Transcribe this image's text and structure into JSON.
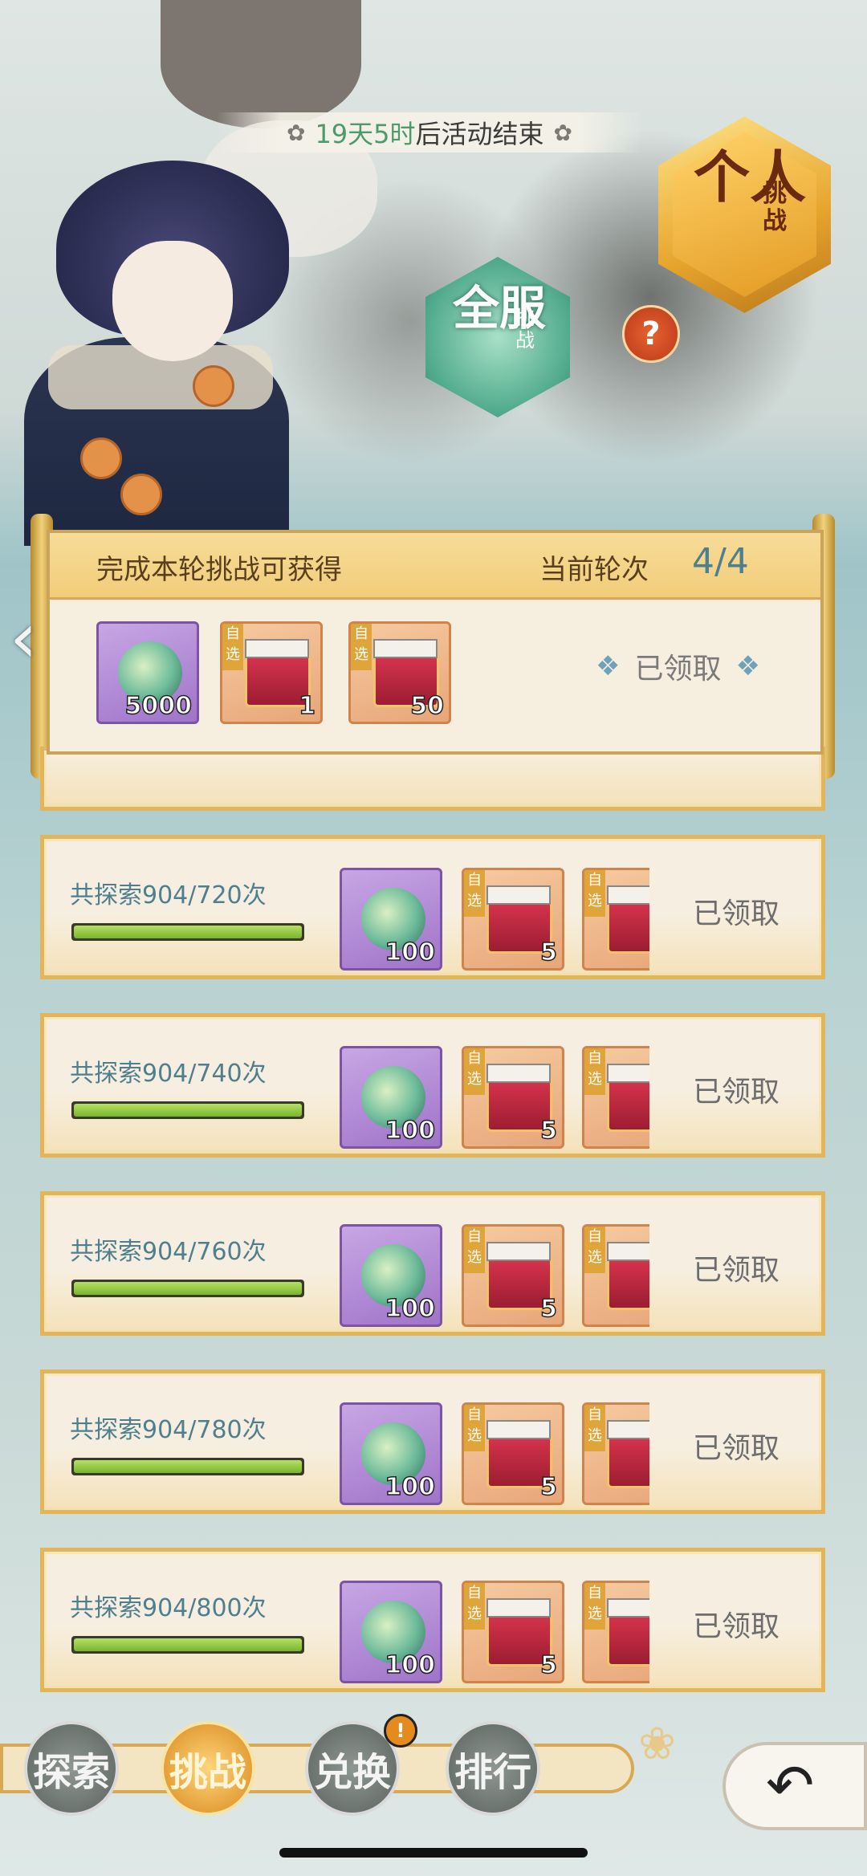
{
  "timer": {
    "highlight": "19天5时",
    "rest": "后活动结束"
  },
  "badges": {
    "personal": {
      "big": "个人",
      "small": "挑战"
    },
    "server": {
      "big": "全服",
      "small": "挑战"
    },
    "help": "?"
  },
  "round_panel": {
    "title": "完成本轮挑战可获得",
    "round_label": "当前轮次",
    "round_value": "4/4",
    "rewards": [
      {
        "type": "item",
        "count": "5000",
        "tag": ""
      },
      {
        "type": "box",
        "count": "1",
        "tag": "自选"
      },
      {
        "type": "box",
        "count": "50",
        "tag": "自选"
      }
    ],
    "status": "已领取"
  },
  "tasks": [
    {
      "label": "共探索904/720次",
      "progress": 1.0,
      "rewards": [
        "100",
        "5"
      ],
      "tag": "自选",
      "status": "已领取"
    },
    {
      "label": "共探索904/740次",
      "progress": 1.0,
      "rewards": [
        "100",
        "5"
      ],
      "tag": "自选",
      "status": "已领取"
    },
    {
      "label": "共探索904/760次",
      "progress": 1.0,
      "rewards": [
        "100",
        "5"
      ],
      "tag": "自选",
      "status": "已领取"
    },
    {
      "label": "共探索904/780次",
      "progress": 1.0,
      "rewards": [
        "100",
        "5"
      ],
      "tag": "自选",
      "status": "已领取"
    },
    {
      "label": "共探索904/800次",
      "progress": 1.0,
      "rewards": [
        "100",
        "5"
      ],
      "tag": "自选",
      "status": "已领取"
    }
  ],
  "nav": [
    {
      "label": "探索"
    },
    {
      "label": "挑战"
    },
    {
      "label": "兑换"
    },
    {
      "label": "排行"
    }
  ],
  "notice_badge": "!",
  "icons": {
    "back": "chevron-left-icon",
    "return": "return-arrow-icon",
    "lotus": "lotus-icon",
    "flower": "flower-icon"
  }
}
